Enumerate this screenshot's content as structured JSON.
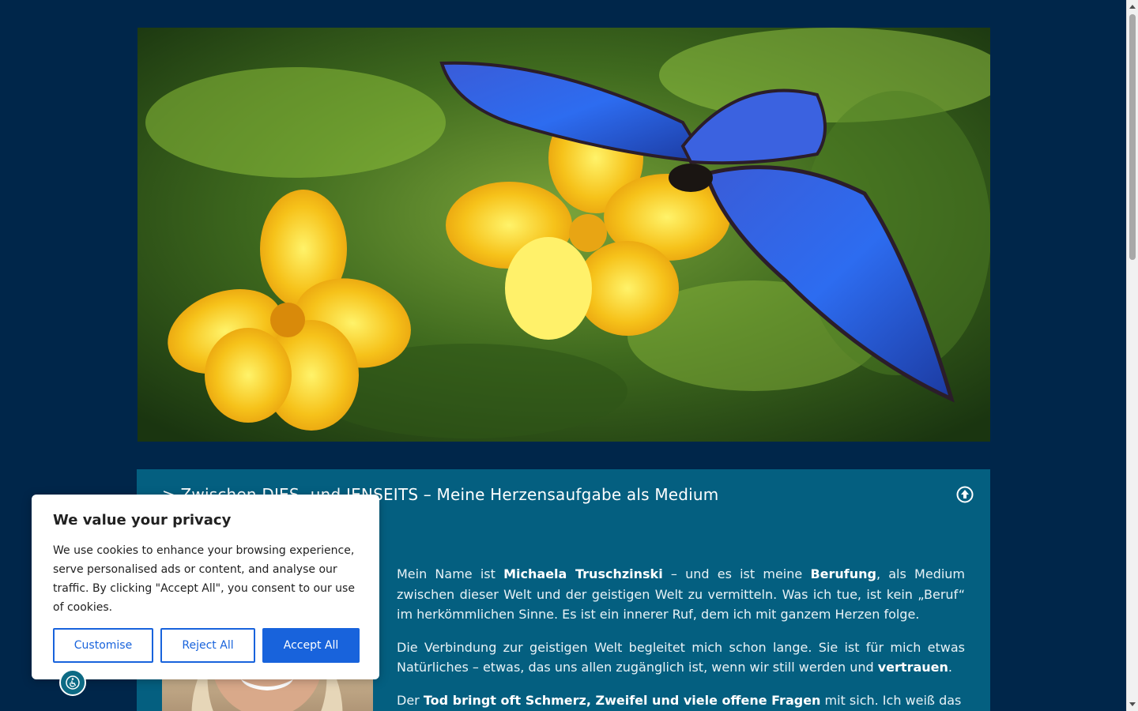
{
  "hero": {
    "image": "butterfly-on-yellow-flowers"
  },
  "section": {
    "title": "> Zwischen DIES- und JENSEITS – Meine Herzensaufgabe als Medium",
    "toggle_icon": "circle-arrow-up-icon",
    "paragraphs": [
      {
        "parts": [
          {
            "t": "Mein Name ist ",
            "b": false
          },
          {
            "t": "Michaela Truschzinski",
            "b": true
          },
          {
            "t": " – und es ist meine ",
            "b": false
          },
          {
            "t": "Berufung",
            "b": true
          },
          {
            "t": ", als Medium zwischen dieser Welt und der geistigen Welt zu vermitteln. Was ich tue, ist kein „Beruf“ im herkömmlichen Sinne. Es ist ein innerer Ruf, dem ich mit ganzem Herzen folge.",
            "b": false
          }
        ]
      },
      {
        "parts": [
          {
            "t": "Die Verbindung zur geistigen Welt begleitet mich schon lange. Sie ist für mich etwas Natürliches – etwas, das uns allen zugänglich ist, wenn wir still werden und ",
            "b": false
          },
          {
            "t": "vertrauen",
            "b": true
          },
          {
            "t": ".",
            "b": false
          }
        ]
      },
      {
        "parts": [
          {
            "t": "Der ",
            "b": false
          },
          {
            "t": "Tod bringt oft Schmerz, Zweifel und viele offene Fragen",
            "b": true
          },
          {
            "t": " mit sich. Ich weiß das",
            "b": false
          }
        ]
      }
    ]
  },
  "cookie": {
    "title": "We value your privacy",
    "description": "We use cookies to enhance your browsing experience, serve personalised ads or content, and analyse our traffic. By clicking \"Accept All\", you consent to our use of cookies.",
    "customise_label": "Customise",
    "reject_label": "Reject All",
    "accept_label": "Accept All"
  },
  "accessibility": {
    "icon": "accessibility-icon"
  },
  "colors": {
    "page_bg": "#00264a",
    "section_bg": "#045f80",
    "accent": "#1863dc"
  }
}
